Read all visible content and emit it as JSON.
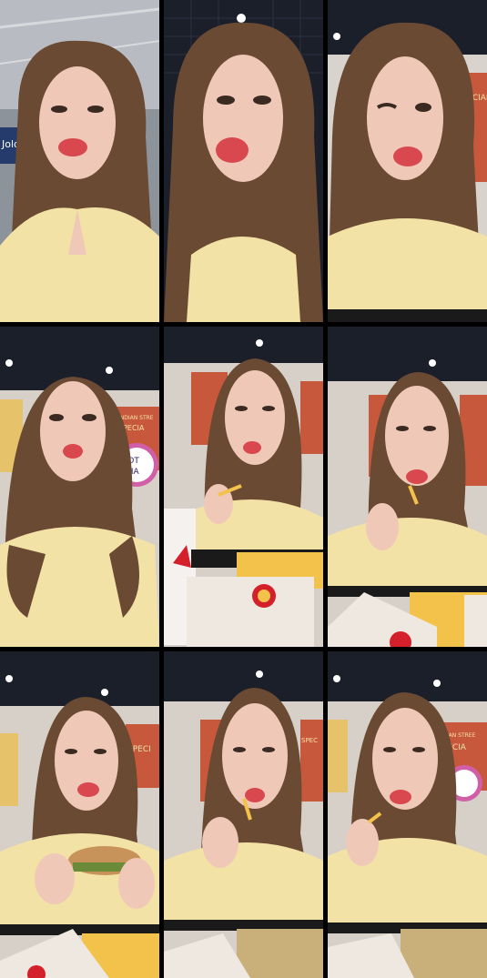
{
  "collage": {
    "frames": [
      {
        "id": "frame-1",
        "scene": "close-up, mall ceiling"
      },
      {
        "id": "frame-2",
        "scene": "close-up, dark ceiling"
      },
      {
        "id": "frame-3",
        "scene": "close-up, food court"
      },
      {
        "id": "frame-4",
        "scene": "food court, talking"
      },
      {
        "id": "frame-5",
        "scene": "eating fries"
      },
      {
        "id": "frame-6",
        "scene": "eating fries"
      },
      {
        "id": "frame-7",
        "scene": "eating burger"
      },
      {
        "id": "frame-8",
        "scene": "eating fries"
      },
      {
        "id": "frame-9",
        "scene": "eating fries"
      }
    ],
    "colors": {
      "background": "#000000",
      "hair": "#6b4a33",
      "skin": "#f0c8b8",
      "shirt": "#f3e2a6",
      "lips": "#d9474f",
      "ceiling": "#1b1f2a",
      "poster": "#c8583c",
      "fries": "#f2c24a",
      "mcd_red": "#d4202a",
      "bag": "#efe8e0"
    }
  },
  "signage": {
    "frame1_sign": "Jolome",
    "frame3_sign": "SPECIAL",
    "frame4_sign_a": "INDIAN STRE",
    "frame4_sign_b": "SPECIA",
    "frame4_round": "ROT",
    "frame4_round_b": "SHA",
    "frame7_sign": "SPECI",
    "frame8_sign": "SPEC",
    "frame9_sign": "INDIAN STREE",
    "frame9_sign_b": "SPECIA"
  }
}
